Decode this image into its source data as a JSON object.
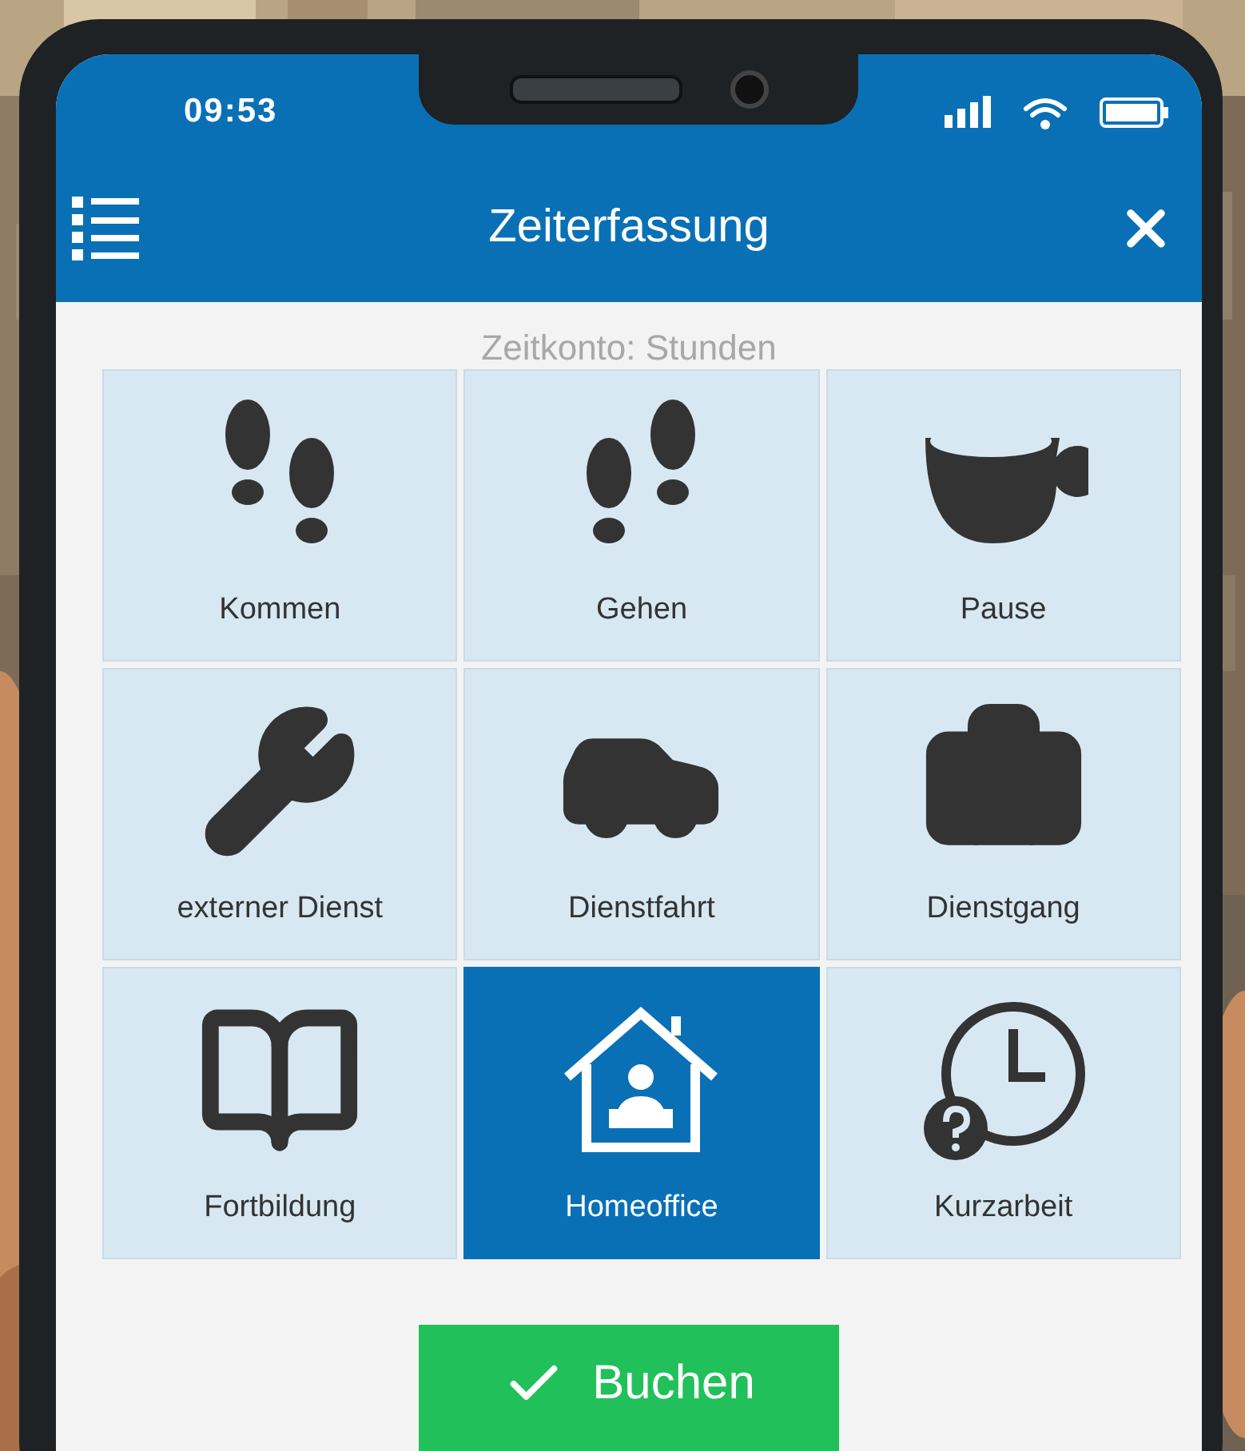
{
  "status_bar": {
    "time": "09:53"
  },
  "header": {
    "title": "Zeiterfassung"
  },
  "subtitle": "Zeitkonto: Stunden",
  "tiles": [
    {
      "kind": "arrive",
      "label": "Kommen",
      "selected": false
    },
    {
      "kind": "leave",
      "label": "Gehen",
      "selected": false
    },
    {
      "kind": "break",
      "label": "Pause",
      "selected": false
    },
    {
      "kind": "external",
      "label": "externer Dienst",
      "selected": false
    },
    {
      "kind": "drive",
      "label": "Dienstfahrt",
      "selected": false
    },
    {
      "kind": "errand",
      "label": "Dienstgang",
      "selected": false
    },
    {
      "kind": "training",
      "label": "Fortbildung",
      "selected": false
    },
    {
      "kind": "home",
      "label": "Homeoffice",
      "selected": true
    },
    {
      "kind": "shorttime",
      "label": "Kurzarbeit",
      "selected": false
    }
  ],
  "book_button": {
    "label": "Buchen"
  }
}
